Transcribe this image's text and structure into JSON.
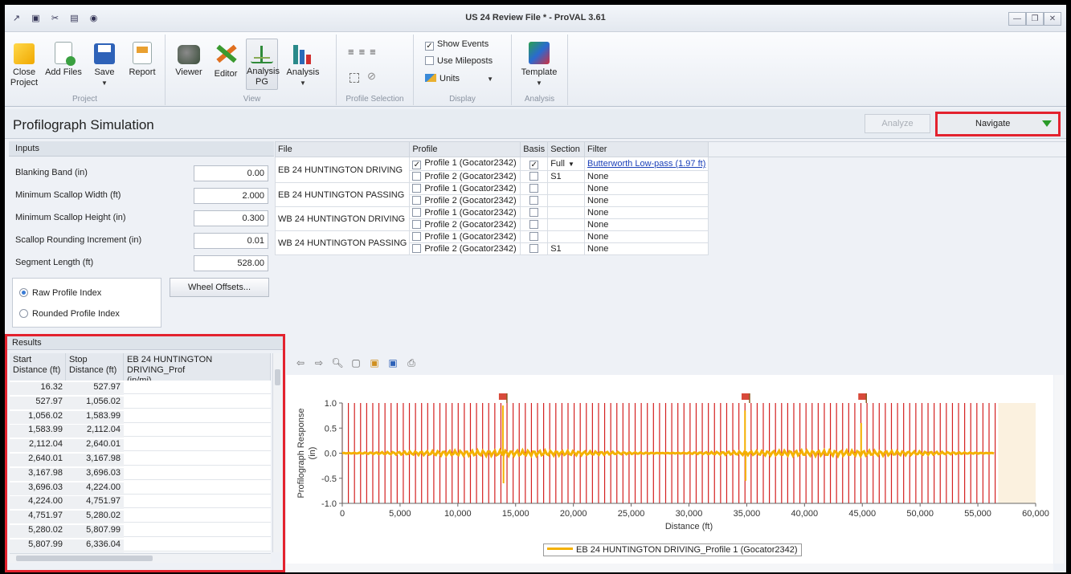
{
  "window": {
    "title": "US 24 Review File * - ProVAL 3.61",
    "controls": [
      "—",
      "❐",
      "✕"
    ]
  },
  "qat": [
    {
      "icon": "app-icon",
      "glyph": "↗"
    },
    {
      "icon": "image-icon",
      "glyph": "▣"
    },
    {
      "icon": "tools-icon",
      "glyph": "✂"
    },
    {
      "icon": "document-icon",
      "glyph": "▤"
    },
    {
      "icon": "help-icon",
      "glyph": "◉"
    }
  ],
  "ribbon": {
    "groups": [
      {
        "caption": "Project",
        "buttons": [
          "Close\nProject",
          "Add Files",
          "Save",
          "Report"
        ]
      },
      {
        "caption": "View",
        "buttons": [
          "Viewer",
          "Editor",
          "Analysis\nPG",
          "Analysis"
        ]
      },
      {
        "caption": "Profile Selection"
      },
      {
        "caption": "Display",
        "show_events": "Show Events",
        "use_mileposts": "Use Mileposts",
        "units": "Units"
      },
      {
        "caption": "Analysis",
        "template": "Template"
      }
    ]
  },
  "header": {
    "title": "Profilograph Simulation",
    "analyze": "Analyze",
    "navigate": "Navigate"
  },
  "inputs": {
    "title": "Inputs",
    "fields": [
      {
        "label": "Blanking Band (in)",
        "value": "0.00"
      },
      {
        "label": "Minimum Scallop Width (ft)",
        "value": "2.000"
      },
      {
        "label": "Minimum Scallop Height (in)",
        "value": "0.300"
      },
      {
        "label": "Scallop Rounding Increment (in)",
        "value": "0.01"
      },
      {
        "label": "Segment Length (ft)",
        "value": "528.00"
      }
    ],
    "radio_raw": "Raw Profile Index",
    "radio_rounded": "Rounded Profile Index",
    "wheel_offsets": "Wheel Offsets..."
  },
  "files": {
    "headers": [
      "File",
      "Profile",
      "Basis",
      "Section",
      "Filter"
    ],
    "groups": [
      {
        "file": "EB 24 HUNTINGTON DRIVING",
        "rows": [
          {
            "profile": "Profile 1 (Gocator2342)",
            "checked": true,
            "basis": true,
            "section": "Full",
            "filter": "Butterworth Low-pass (1.97 ft)"
          },
          {
            "profile": "Profile 2 (Gocator2342)",
            "checked": false,
            "basis": false,
            "section": "S1",
            "filter": "None"
          }
        ]
      },
      {
        "file": "EB 24 HUNTINGTON PASSING",
        "rows": [
          {
            "profile": "Profile 1 (Gocator2342)",
            "checked": false,
            "basis": false,
            "section": "",
            "filter": "None"
          },
          {
            "profile": "Profile 2 (Gocator2342)",
            "checked": false,
            "basis": false,
            "section": "",
            "filter": "None"
          }
        ]
      },
      {
        "file": "WB 24 HUNTINGTON DRIVING",
        "rows": [
          {
            "profile": "Profile 1 (Gocator2342)",
            "checked": false,
            "basis": false,
            "section": "",
            "filter": "None"
          },
          {
            "profile": "Profile 2 (Gocator2342)",
            "checked": false,
            "basis": false,
            "section": "",
            "filter": "None"
          }
        ]
      },
      {
        "file": "WB 24 HUNTINGTON PASSING",
        "rows": [
          {
            "profile": "Profile 1 (Gocator2342)",
            "checked": false,
            "basis": false,
            "section": "",
            "filter": "None"
          },
          {
            "profile": "Profile 2 (Gocator2342)",
            "checked": false,
            "basis": false,
            "section": "S1",
            "filter": "None"
          }
        ]
      }
    ]
  },
  "results": {
    "title": "Results",
    "col_start": "Start\nDistance (ft)",
    "col_stop": "Stop\nDistance (ft)",
    "col_third": "EB 24 HUNTINGTON DRIVING_Prof\n(in/mi)",
    "rows": [
      [
        "16.32",
        "527.97"
      ],
      [
        "527.97",
        "1,056.02"
      ],
      [
        "1,056.02",
        "1,583.99"
      ],
      [
        "1,583.99",
        "2,112.04"
      ],
      [
        "2,112.04",
        "2,640.01"
      ],
      [
        "2,640.01",
        "3,167.98"
      ],
      [
        "3,167.98",
        "3,696.03"
      ],
      [
        "3,696.03",
        "4,224.00"
      ],
      [
        "4,224.00",
        "4,751.97"
      ],
      [
        "4,751.97",
        "5,280.02"
      ],
      [
        "5,280.02",
        "5,807.99"
      ],
      [
        "5,807.99",
        "6,336.04"
      ]
    ]
  },
  "chart_data": {
    "type": "line",
    "xlabel": "Distance (ft)",
    "ylabel": "Profilograph Response\n(in)",
    "xlim": [
      0,
      60000
    ],
    "ylim": [
      -1.0,
      1.0
    ],
    "xticks": [
      "0",
      "5,000",
      "10,000",
      "15,000",
      "20,000",
      "25,000",
      "30,000",
      "35,000",
      "40,000",
      "45,000",
      "50,000",
      "55,000",
      "60,000"
    ],
    "yticks": [
      "1.0",
      "0.5",
      "0.0",
      "-0.5",
      "-1.0"
    ],
    "data_extent": [
      0,
      56500
    ],
    "segment_length": 528,
    "spikes": [
      {
        "x": 13900,
        "y": 0.95
      },
      {
        "x": 13950,
        "y": -0.6
      },
      {
        "x": 34850,
        "y": 0.85
      },
      {
        "x": 34900,
        "y": -0.55
      },
      {
        "x": 44900,
        "y": 0.6
      }
    ],
    "event_flags": [
      13900,
      34900,
      45000
    ],
    "series": [
      {
        "name": "EB 24 HUNTINGTON DRIVING_Profile 1 (Gocator2342)",
        "color": "#f4b000"
      }
    ],
    "band_color": "#d42020"
  }
}
